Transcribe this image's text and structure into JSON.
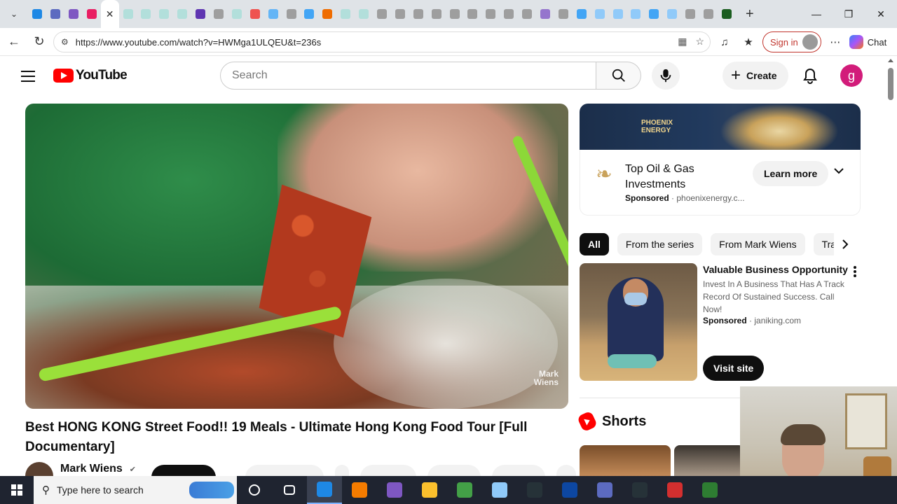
{
  "browser": {
    "address_url": "https://www.youtube.com/watch?v=HWMga1ULQEU&t=236s",
    "signin_label": "Sign in",
    "chat_label": "Chat",
    "tab_favicon_colors": [
      "#1e88e5",
      "#5c6bc0",
      "#7e57c2",
      "#e91e63",
      "#ffffff",
      "#b2dfdb",
      "#b2dfdb",
      "#b2dfdb",
      "#b2dfdb",
      "#5e35b1",
      "#9e9e9e",
      "#b2dfdb",
      "#ef5350",
      "#64b5f6",
      "#9e9e9e",
      "#42a5f5",
      "#ef6c00",
      "#b2dfdb",
      "#b2dfdb",
      "#9e9e9e",
      "#9e9e9e",
      "#9e9e9e",
      "#9e9e9e",
      "#9e9e9e",
      "#9e9e9e",
      "#9e9e9e",
      "#9e9e9e",
      "#9e9e9e",
      "#9575cd",
      "#9e9e9e",
      "#42a5f5",
      "#90caf9",
      "#90caf9",
      "#90caf9",
      "#42a5f5",
      "#90caf9",
      "#9e9e9e",
      "#9e9e9e",
      "#1b5e20"
    ]
  },
  "youtube": {
    "logo_text": "YouTube",
    "search_placeholder": "Search",
    "create_label": "Create",
    "avatar_letter": "g",
    "video": {
      "title": "Best HONG KONG Street Food!! 19 Meals - Ultimate Hong Kong Food Tour [Full Documentary]",
      "channel": "Mark Wiens",
      "watermark": "Mark\nWiens"
    },
    "ad": {
      "brand_text": "PHOENIX\nENERGY",
      "title": "Top Oil & Gas Investments",
      "sponsored": "Sponsored",
      "domain": "phoenixenergy.c...",
      "cta": "Learn more"
    },
    "chips": [
      "All",
      "From the series",
      "From Mark Wiens",
      "Travel"
    ],
    "sponsored_card": {
      "title": "Valuable Business Opportunity",
      "description": "Invest In A Business That Has A Track Record Of Sustained Success. Call Now!",
      "sponsored": "Sponsored",
      "domain": "janiking.com",
      "cta": "Visit site"
    },
    "shorts_label": "Shorts"
  },
  "taskbar": {
    "search_placeholder": "Type here to search",
    "app_colors": [
      "#ffffff",
      "#ffffff",
      "#1e88e5",
      "#f57c00",
      "#7e57c2",
      "#fbc02d",
      "#43a047",
      "#90caf9",
      "#263238",
      "#0d47a1",
      "#5c6bc0",
      "#263238",
      "#d32f2f",
      "#2e7d32"
    ]
  }
}
